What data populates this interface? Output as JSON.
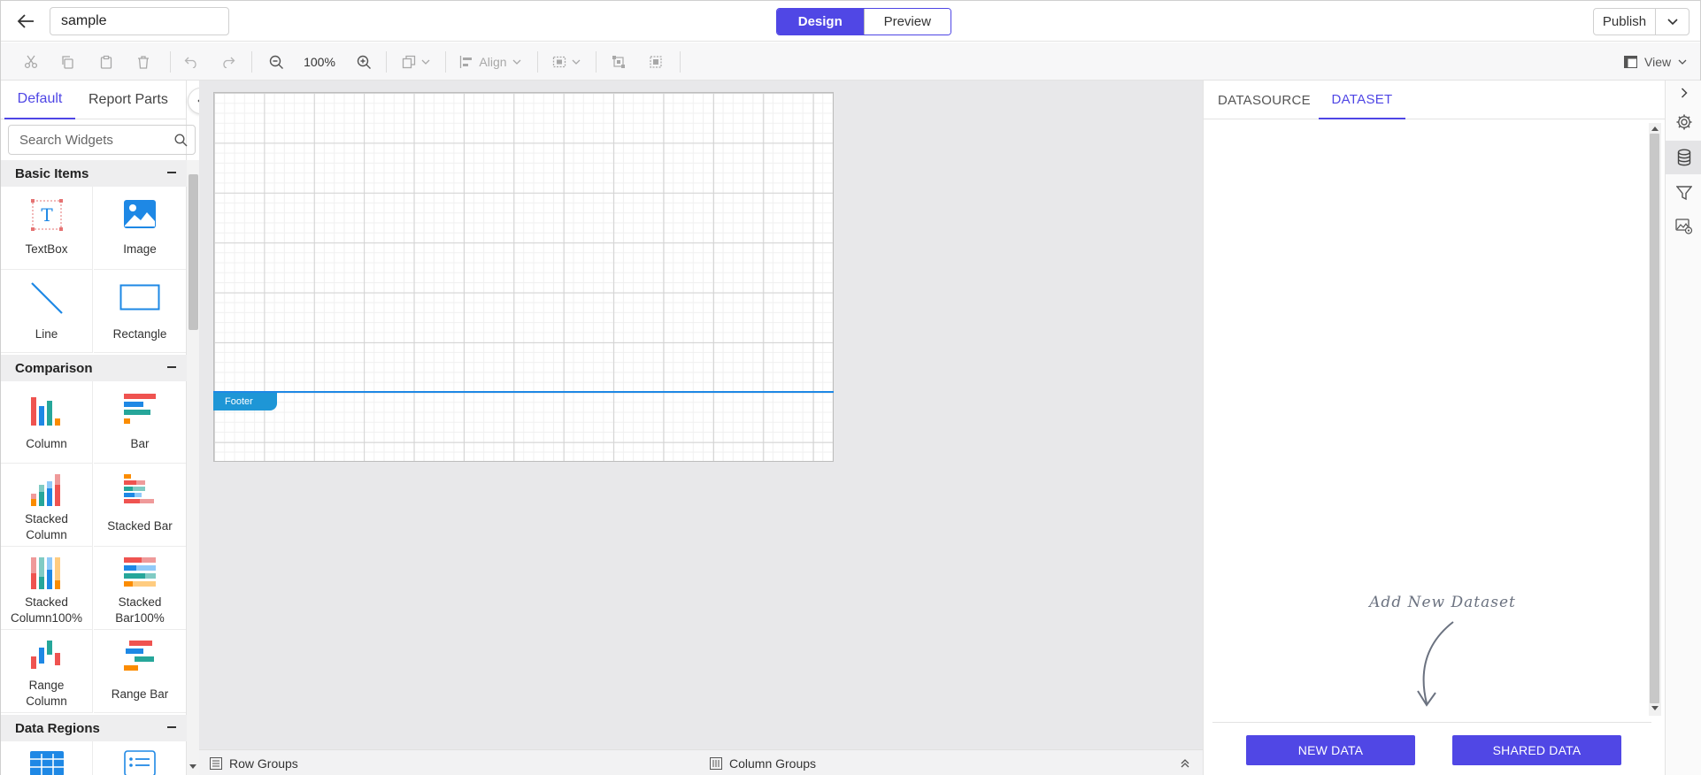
{
  "header": {
    "report_name": "sample",
    "modes": {
      "design": "Design",
      "preview": "Preview",
      "active": "design"
    },
    "publish_label": "Publish"
  },
  "toolbar": {
    "zoom_level": "100%",
    "align_label": "Align",
    "view_label": "View"
  },
  "left_panel": {
    "tabs": [
      {
        "label": "Default",
        "active": true
      },
      {
        "label": "Report Parts",
        "active": false
      }
    ],
    "search_placeholder": "Search Widgets",
    "categories": [
      {
        "label": "Basic Items"
      },
      {
        "label": "Comparison"
      },
      {
        "label": "Data Regions"
      }
    ],
    "basic_items": [
      "TextBox",
      "Image",
      "Line",
      "Rectangle"
    ],
    "comparison": [
      "Column",
      "Bar",
      "Stacked\nColumn",
      "Stacked Bar",
      "Stacked\nColumn100%",
      "Stacked\nBar100%",
      "Range\nColumn",
      "Range Bar"
    ]
  },
  "canvas": {
    "footer_label": "Footer"
  },
  "groups_bar": {
    "row_groups": "Row Groups",
    "column_groups": "Column Groups"
  },
  "right_panel": {
    "tabs": [
      {
        "label": "DATASOURCE",
        "active": false
      },
      {
        "label": "DATASET",
        "active": true
      }
    ],
    "hint": "Add New Dataset",
    "new_data": "NEW DATA",
    "shared_data": "SHARED DATA"
  },
  "side_strip": {
    "icons": [
      "chevron-right-icon",
      "gear-icon",
      "database-icon",
      "filter-icon",
      "image-settings-icon"
    ],
    "active": "database-icon"
  },
  "colors": {
    "accent": "#5047e5",
    "footer_blue": "#1e96d6"
  }
}
